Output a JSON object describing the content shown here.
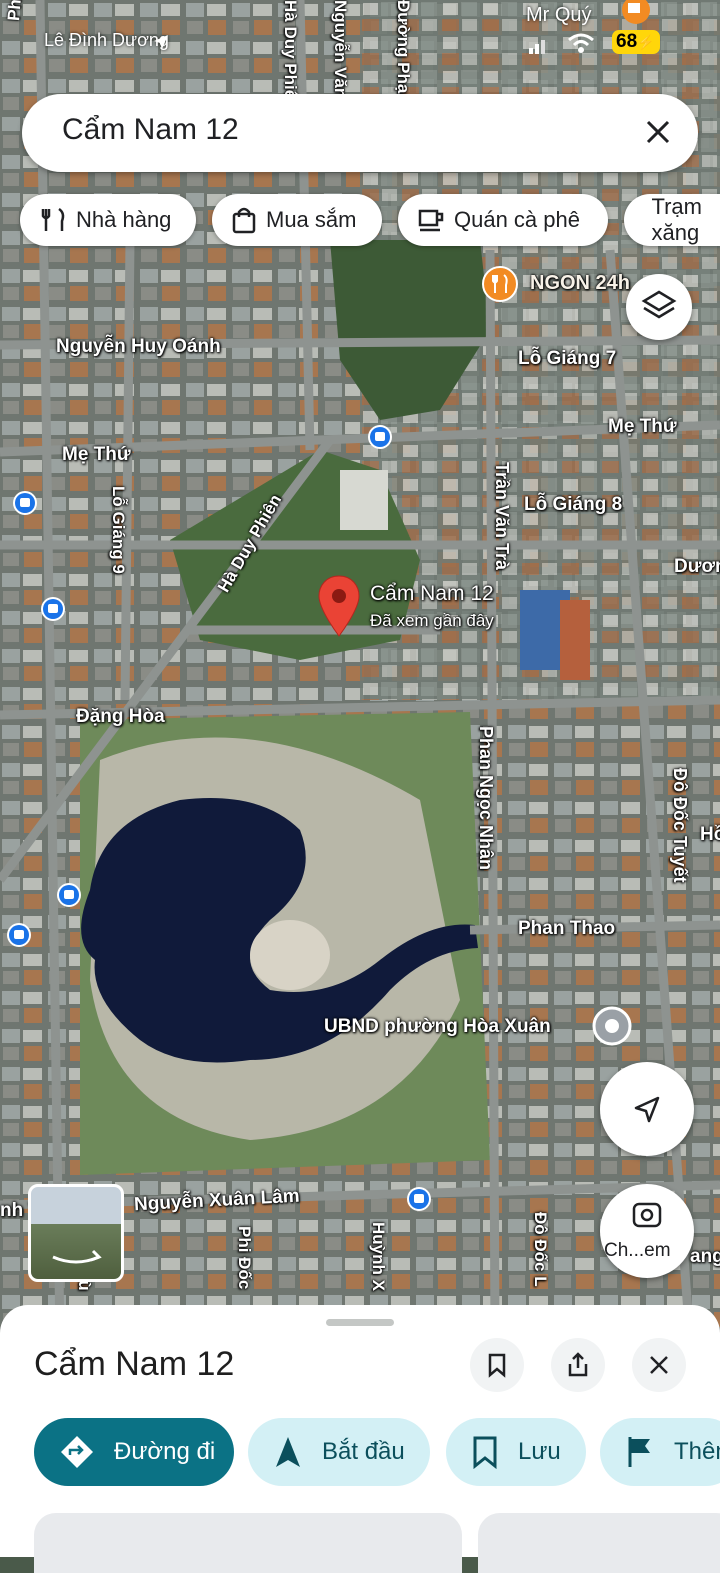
{
  "status_bar": {
    "location_label": "Lê Đình Dương",
    "carrier_label": "Mr Quý",
    "battery": "68"
  },
  "search": {
    "value": "Cẩm Nam 12"
  },
  "chips": [
    {
      "label": "Nhà hàng",
      "icon": "restaurant-icon"
    },
    {
      "label": "Mua sắm",
      "icon": "shopping-bag-icon"
    },
    {
      "label": "Quán cà phê",
      "icon": "coffee-icon"
    },
    {
      "label": "Trạm xăng",
      "icon": "gas-station-icon"
    }
  ],
  "map": {
    "pin": {
      "title": "Cẩm Nam 12",
      "subtitle": "Đã xem gần đây"
    },
    "poi_restaurant": "NGON 24h",
    "poi_ubnd": "UBND phường Hòa Xuân",
    "streets": {
      "pham_hung": "Phạm Hùng",
      "ha_duy_phien_top": "Hà Duy Phiên",
      "nguyen_van": "Nguyễn Văn",
      "duong_pham": "Đường Phạm",
      "tran_van_tra_top": "Trần Văn Trà",
      "nguyen_huy_oanh": "Nguyễn Huy Oánh",
      "lo_giang_7": "Lỗ Giáng 7",
      "me_thu_left": "Mẹ Thứ",
      "me_thu_right": "Mẹ Thứ",
      "lo_giang_8": "Lỗ Giáng 8",
      "lo_giang_9": "Lỗ Giáng 9",
      "ha_duy_phien": "Hà Duy Phiên",
      "tran_van_tra": "Trần Văn Trà",
      "duong": "Dươn",
      "dang_hoa": "Đặng Hòa",
      "phan_ngoc_nhan": "Phan Ngọc Nhân",
      "do_doc_tuyet": "Đô Đốc Tuyết",
      "ho": "Hồ",
      "phan_thao": "Phan Thao",
      "nguyen_xuan_lam": "Nguyễn Xuân Lâm",
      "nh_v": "nh V",
      "phi_doc": "Phi Đốc",
      "huynh_x": "Huỳnh X",
      "do_doc_l": "Đô Đốc L",
      "hu": "Hù",
      "ang": "ang"
    },
    "camera_label": "Ch...em"
  },
  "sheet": {
    "title": "Cẩm Nam 12",
    "actions": [
      {
        "label": "Đường đi",
        "icon": "directions-icon"
      },
      {
        "label": "Bắt đầu",
        "icon": "navigation-arrow-icon"
      },
      {
        "label": "Lưu",
        "icon": "bookmark-icon"
      },
      {
        "label": "Thêm",
        "icon": "flag-icon"
      }
    ]
  }
}
